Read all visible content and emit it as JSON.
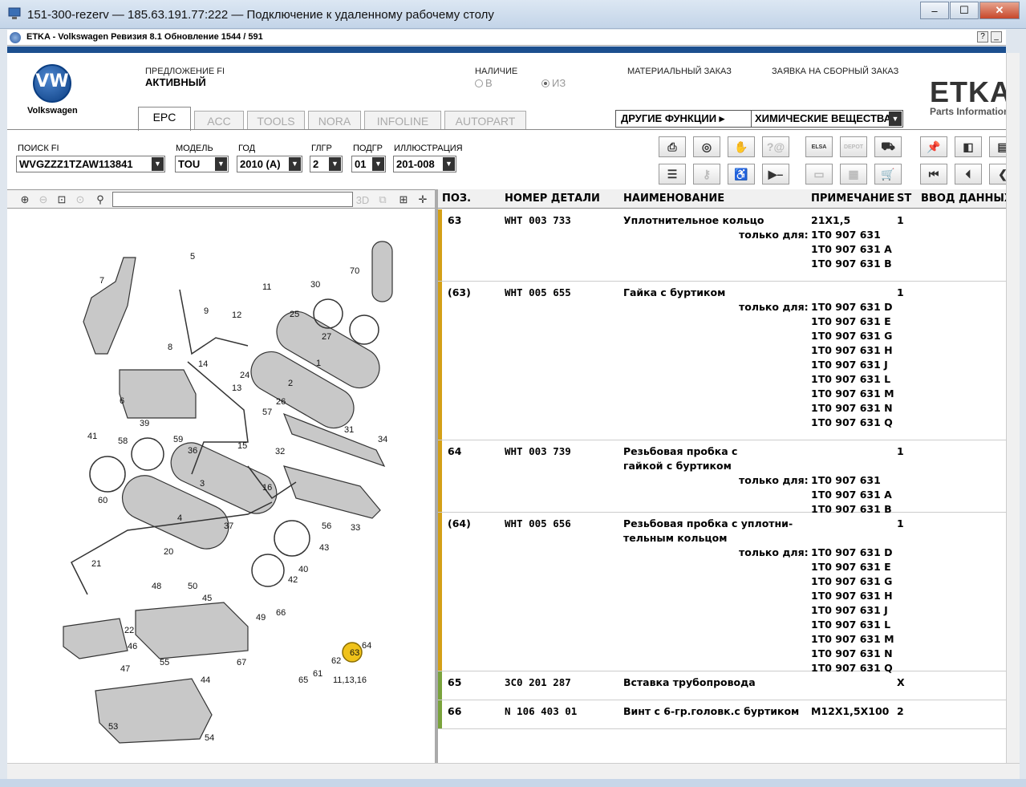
{
  "rdp": {
    "title": "151-300-rezerv — 185.63.191.77:222 — Подключение к удаленному рабочему столу"
  },
  "app": {
    "title": "ETKA - Volkswagen Ревизия 8.1 Обновление 1544 / 591",
    "help": "?",
    "min": "_"
  },
  "brand": {
    "name": "Volkswagen",
    "logo": "VW",
    "etka_logo": "ETKA",
    "etka_sub": "Parts Information"
  },
  "header": {
    "offer_label": "ПРЕДЛОЖЕНИЕ FI",
    "offer_value": "АКТИВНЫЙ",
    "availability_label": "НАЛИЧИЕ",
    "opt_in": "В",
    "opt_out": "ИЗ",
    "material_order": "МАТЕРИАЛЬНЫЙ ЗАКАЗ",
    "collective_order": "ЗАЯВКА НА СБОРНЫЙ ЗАКАЗ"
  },
  "tabs": [
    "EPC",
    "ACC",
    "TOOLS",
    "NORA",
    "INFOLINE",
    "AUTOPART"
  ],
  "other_functions": {
    "label": "ДРУГИЕ ФУНКЦИИ ▸",
    "selected": "ХИМИЧЕСКИЕ ВЕЩЕСТВА"
  },
  "search": {
    "fi_label": "ПОИСК FI",
    "fi_value": "WVGZZZ1TZAW113841",
    "model_label": "МОДЕЛЬ",
    "model_value": "TOU",
    "year_label": "ГОД",
    "year_value": "2010 (A)",
    "group_label": "ГЛГР",
    "group_value": "2",
    "subgroup_label": "ПОДГР",
    "subgroup_value": "01",
    "illustration_label": "ИЛЛЮСТРАЦИЯ",
    "illustration_value": "201-008"
  },
  "toolbar": {
    "elsa": "ELSA",
    "depot": "DEPOT"
  },
  "table": {
    "headers": [
      "ПОЗ.",
      "НОМЕР ДЕТАЛИ",
      "НАИМЕНОВАНИЕ",
      "ПРИМЕЧАНИЕ",
      "ST",
      "ВВОД ДАННЫХ"
    ],
    "only_for": "только для:",
    "rows": [
      {
        "pos": "63",
        "part": "WHT 003 733",
        "name": [
          "Уплотнительное кольцо"
        ],
        "note": "21X1,5",
        "st": "1",
        "models": [
          "1T0 907 631",
          "1T0 907 631 A",
          "1T0 907 631 B"
        ],
        "color": "#d4a017"
      },
      {
        "pos": "(63)",
        "part": "WHT 005 655",
        "name": [
          "Гайка с буртиком"
        ],
        "note": "",
        "st": "1",
        "models": [
          "1T0 907 631 D",
          "1T0 907 631 E",
          "1T0 907 631 G",
          "1T0 907 631 H",
          "1T0 907 631 J",
          "1T0 907 631 L",
          "1T0 907 631 M",
          "1T0 907 631 N",
          "1T0 907 631 Q"
        ],
        "color": "#d4a017"
      },
      {
        "pos": "64",
        "part": "WHT 003 739",
        "name": [
          "Резьбовая пробка с",
          "гайкой с буртиком"
        ],
        "note": "",
        "st": "1",
        "models": [
          "1T0 907 631",
          "1T0 907 631 A",
          "1T0 907 631 B"
        ],
        "color": "#d4a017"
      },
      {
        "pos": "(64)",
        "part": "WHT 005 656",
        "name": [
          "Резьбовая пробка с уплотни-",
          "тельным кольцом"
        ],
        "note": "",
        "st": "1",
        "models": [
          "1T0 907 631 D",
          "1T0 907 631 E",
          "1T0 907 631 G",
          "1T0 907 631 H",
          "1T0 907 631 J",
          "1T0 907 631 L",
          "1T0 907 631 M",
          "1T0 907 631 N",
          "1T0 907 631 Q"
        ],
        "color": "#d4a017"
      },
      {
        "pos": "65",
        "part": "3C0 201 287",
        "name": [
          "Вставка трубопровода"
        ],
        "note": "",
        "st": "X",
        "models": [],
        "color": "#7aa33c"
      },
      {
        "pos": "66",
        "part": "N  106 403 01",
        "name": [
          "Винт с 6-гр.головк.с буртиком"
        ],
        "note": "M12X1,5X100",
        "st": "2",
        "models": [],
        "color": "#7aa33c"
      }
    ]
  },
  "diagram_labels": [
    "1",
    "2",
    "3",
    "4",
    "5",
    "6",
    "7",
    "8",
    "9",
    "11",
    "12",
    "13",
    "14",
    "15",
    "16",
    "20",
    "21",
    "22",
    "24",
    "25",
    "26",
    "27",
    "30",
    "31",
    "32",
    "33",
    "34",
    "36",
    "37",
    "39",
    "40",
    "41",
    "42",
    "43",
    "44",
    "45",
    "46",
    "47",
    "48",
    "49",
    "50",
    "53",
    "54",
    "55",
    "56",
    "57",
    "58",
    "59",
    "60",
    "61",
    "62",
    "63",
    "64",
    "65",
    "66",
    "67",
    "70"
  ],
  "diagram_extra": "11,13,16",
  "colors": {
    "accent_blue": "#1c4f8f",
    "highlight": "#f0c21a"
  }
}
